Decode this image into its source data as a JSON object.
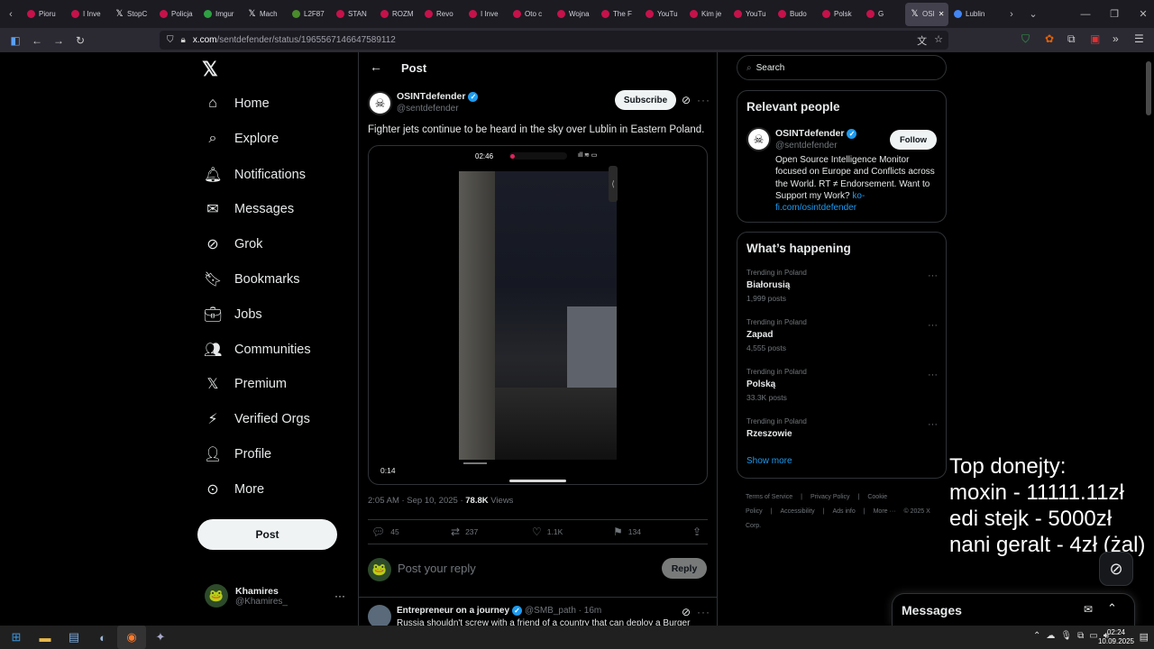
{
  "browser": {
    "tabs": [
      {
        "label": "Pioru",
        "fav": "red"
      },
      {
        "label": "I Inve",
        "fav": "red"
      },
      {
        "label": "StopC",
        "fav": "x"
      },
      {
        "label": "Policja",
        "fav": "red"
      },
      {
        "label": "Imgur",
        "fav": "green"
      },
      {
        "label": "Mach",
        "fav": "x"
      },
      {
        "label": "L2F87",
        "fav": "olive"
      },
      {
        "label": "STAN",
        "fav": "red"
      },
      {
        "label": "ROZM",
        "fav": "red"
      },
      {
        "label": "Revo",
        "fav": "red"
      },
      {
        "label": "I Inve",
        "fav": "red"
      },
      {
        "label": "Oto c",
        "fav": "red"
      },
      {
        "label": "Wojna",
        "fav": "red"
      },
      {
        "label": "The F",
        "fav": "red"
      },
      {
        "label": "YouTu",
        "fav": "red"
      },
      {
        "label": "Kim je",
        "fav": "red"
      },
      {
        "label": "YouTu",
        "fav": "red"
      },
      {
        "label": "Budo",
        "fav": "red"
      },
      {
        "label": "Polsk",
        "fav": "red"
      },
      {
        "label": "G",
        "fav": "red"
      }
    ],
    "active_tab": "OSI",
    "extra_tab": "Lublin",
    "url_host": "x.com",
    "url_path": "/sentdefender/status/1965567146647589112"
  },
  "nav": {
    "items": [
      "Home",
      "Explore",
      "Notifications",
      "Messages",
      "Grok",
      "Bookmarks",
      "Jobs",
      "Communities",
      "Premium",
      "Verified Orgs",
      "Profile",
      "More"
    ],
    "post_button": "Post",
    "account_name": "Khamires",
    "account_handle": "@Khamires_"
  },
  "header": {
    "title": "Post"
  },
  "post": {
    "author": "OSINTdefender",
    "handle": "@sentdefender",
    "subscribe": "Subscribe",
    "text": "Fighter jets continue to be heard in the sky over Lublin in Eastern Poland.",
    "video_clock": "02:46",
    "video_duration": "0:14",
    "time": "2:05 AM · Sep 10, 2025 · ",
    "views": "78.8K",
    "views_label": " Views",
    "replies": "45",
    "reposts": "237",
    "likes": "1.1K",
    "bookmarks": "134"
  },
  "reply": {
    "placeholder": "Post your reply",
    "button": "Reply"
  },
  "comment": {
    "name": "Entrepreneur on a journey",
    "handle": "@SMB_path · 16m",
    "text": "Russia shouldn't screw with a friend of a country that can deploy a Burger"
  },
  "sidebar": {
    "search_placeholder": "Search",
    "relevant_title": "Relevant people",
    "rp_name": "OSINTdefender",
    "rp_handle": "@sentdefender",
    "follow": "Follow",
    "rp_bio": "Open Source Intelligence Monitor focused on Europe and Conflicts across the World. RT ≠ Endorsement. Want to Support my Work? ",
    "rp_link": "ko-fi.com/osintdefender",
    "happening_title": "What’s happening",
    "trends": [
      {
        "context": "Trending in Poland",
        "title": "Białorusią",
        "count": "1,999 posts"
      },
      {
        "context": "Trending in Poland",
        "title": "Zapad",
        "count": "4,555 posts"
      },
      {
        "context": "Trending in Poland",
        "title": "Polską",
        "count": "33.3K posts"
      },
      {
        "context": "Trending in Poland",
        "title": "Rzeszowie",
        "count": ""
      }
    ],
    "show_more": "Show more",
    "footer": [
      "Terms of Service",
      "|",
      "Privacy Policy",
      "|",
      "Cookie Policy",
      "|",
      "Accessibility",
      "|",
      "Ads info",
      "|",
      "More ···",
      "© 2025 X Corp."
    ]
  },
  "overlay": {
    "lines": [
      "Top donejty:",
      "moxin - 11111.11zł",
      "edi stejk - 5000zł",
      "nani geralt - 4zł (żal)"
    ]
  },
  "messages_drawer": {
    "title": "Messages"
  },
  "taskbar": {
    "time": "02:24",
    "date": "10.09.2025"
  },
  "colors": {
    "accent": "#1d9bf0",
    "background": "#000000",
    "border": "#2f3336",
    "muted": "#71767b"
  }
}
